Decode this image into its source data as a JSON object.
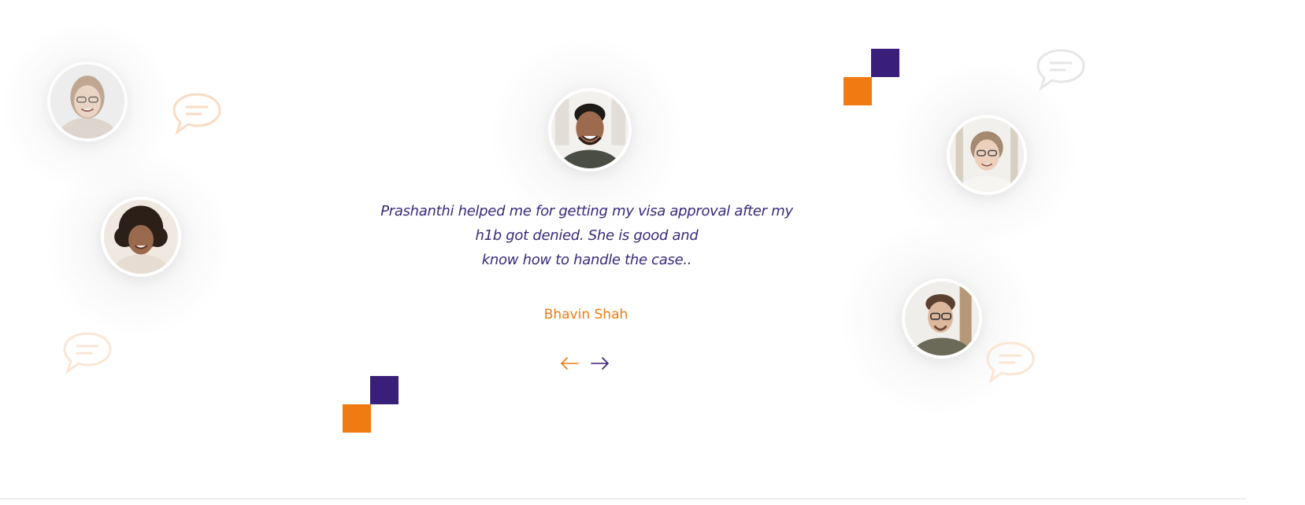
{
  "testimonial": {
    "quote_lines": [
      "Prashanthi helped me for getting my visa approval after my",
      "h1b got denied. She is good and",
      "know how to handle the case.."
    ],
    "author": "Bhavin Shah"
  },
  "navigation": {
    "prev_icon": "arrow-left-icon",
    "next_icon": "arrow-right-icon"
  },
  "colors": {
    "accent_orange": "#f07b12",
    "accent_purple": "#3a1f7a",
    "quote_text": "#3a2a7a"
  }
}
